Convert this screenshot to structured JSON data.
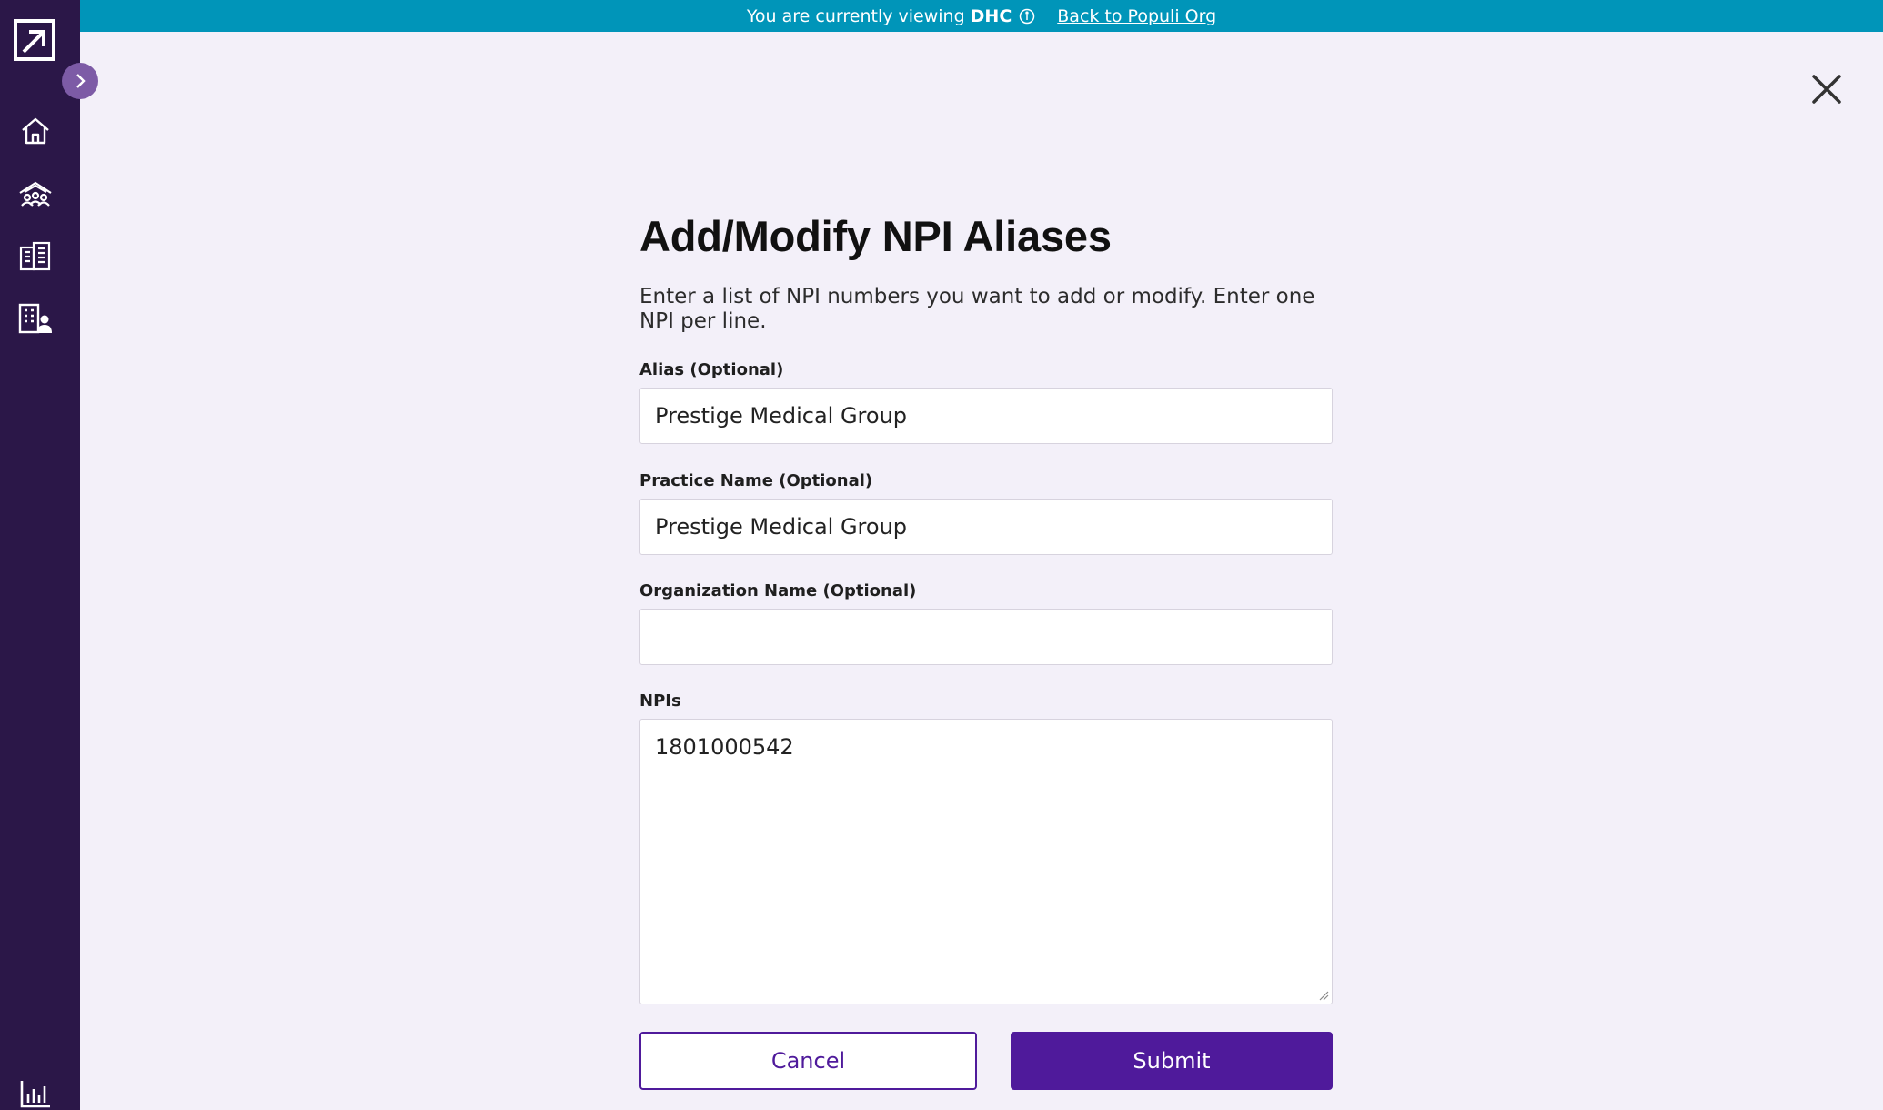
{
  "banner": {
    "viewing_text": "You are currently viewing",
    "org_name": "DHC",
    "back_link": "Back to Populi Org"
  },
  "sidebar": {
    "logo": "populi-logo",
    "items": [
      {
        "icon": "home-icon"
      },
      {
        "icon": "network-icon"
      },
      {
        "icon": "organizations-icon"
      },
      {
        "icon": "practice-directory-icon"
      },
      {
        "icon": "analytics-icon"
      }
    ]
  },
  "form": {
    "title": "Add/Modify NPI Aliases",
    "description": "Enter a list of NPI numbers you want to add or modify. Enter one NPI per line.",
    "alias": {
      "label": "Alias (Optional)",
      "value": "Prestige Medical Group"
    },
    "practice_name": {
      "label": "Practice Name (Optional)",
      "value": "Prestige Medical Group"
    },
    "organization_name": {
      "label": "Organization Name (Optional)",
      "value": ""
    },
    "npis": {
      "label": "NPIs",
      "value": "1801000542"
    },
    "cancel_label": "Cancel",
    "submit_label": "Submit"
  },
  "colors": {
    "sidebar": "#2b1748",
    "banner": "#0095b9",
    "primary": "#4f1a9b",
    "background": "#f3f0f9"
  }
}
